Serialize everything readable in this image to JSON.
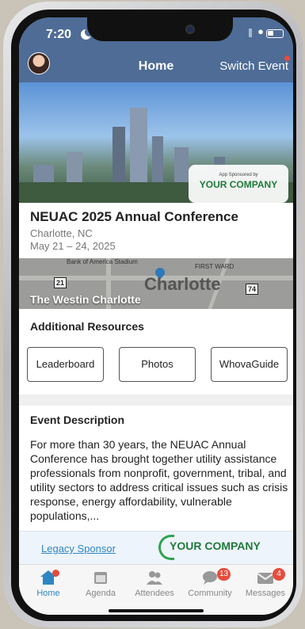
{
  "status": {
    "time": "7:20"
  },
  "header": {
    "title": "Home",
    "switch_label": "Switch Event"
  },
  "hero": {
    "sponsor_small": "App Sponsored by",
    "sponsor_name": "YOUR COMPANY"
  },
  "event": {
    "title": "NEUAC 2025 Annual Conference",
    "location": "Charlotte, NC",
    "dates": "May 21 – 24, 2025"
  },
  "map": {
    "city": "Charlotte",
    "poi": "Bank of America Stadium",
    "district": "FIRST WARD",
    "route1": "21",
    "route2": "74",
    "venue": "The Westin Charlotte"
  },
  "resources": {
    "title": "Additional Resources",
    "buttons": [
      "Leaderboard",
      "Photos",
      "WhovaGuide"
    ]
  },
  "description": {
    "title": "Event Description",
    "text": "For more than 30 years, the NEUAC Annual Conference has brought together utility assistance professionals from nonprofit, government, tribal, and utility sectors to address critical issues such as crisis response, energy affordability, vulnerable populations,..."
  },
  "sponsor_bar": {
    "label": "Legacy Sponsor",
    "company": "YOUR COMPANY"
  },
  "tabs": [
    {
      "label": "Home",
      "icon": "home-icon",
      "active": true
    },
    {
      "label": "Agenda",
      "icon": "calendar-icon"
    },
    {
      "label": "Attendees",
      "icon": "people-icon"
    },
    {
      "label": "Community",
      "icon": "chat-icon",
      "badge": "13"
    },
    {
      "label": "Messages",
      "icon": "envelope-icon",
      "badge": "4"
    }
  ],
  "colors": {
    "header": "#4e6c96",
    "accent": "#2e86c1",
    "sponsor_green": "#1f7a3b",
    "badge": "#e74c3c"
  }
}
